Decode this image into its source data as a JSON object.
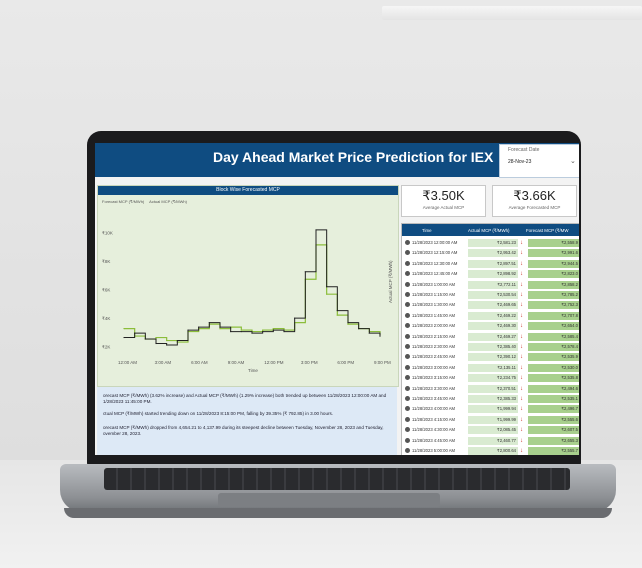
{
  "dashboard": {
    "title": "Day Ahead Market Price Prediction for IEX",
    "date_filter": {
      "label": "Forecast Date",
      "value": "28-Nov-23"
    },
    "kpis": [
      {
        "value": "₹3.50K",
        "label": "Average Actual MCP"
      },
      {
        "value": "₹3.66K",
        "label": "Average Forecasted MCP"
      }
    ],
    "chart": {
      "title": "Block Wise Forecasted MCP",
      "legend": [
        "Forecast MCP (₹/MWh)",
        "Actual MCP (₹/MWh)"
      ],
      "xlabel": "Time",
      "ylabel": "Actual MCP (₹/MWh)"
    },
    "insights": [
      "orecast MCP (₹/MWh) (3.62% increase) and Actual MCP (₹/MWh) (1.29% increase) both trended up between 11/28/2023 12:00:00 AM and 1/28/2023 11:45:00 PM.",
      "ctual MCP (₹/MWh) started trending down on 11/28/2023 8:15:00 PM, falling by 39.35% (₹ 792.85) in 3.00 hours.",
      "orecast MCP (₹/MWh) dropped from 4,654.21 to 4,137.99 during its steepest decline between Tuesday, November 28, 2023 and Tuesday, ovember 28, 2023."
    ],
    "table": {
      "headers": [
        "Time",
        "Actual MCP (₹/MWh)",
        "Forecast MCP (₹/MW"
      ],
      "rows": [
        [
          "11/28/2023 12:00:00 AM",
          "₹2,581.23",
          "₹2,558.9"
        ],
        [
          "11/28/2023 12:15:00 AM",
          "₹2,953.42",
          "₹2,991.6"
        ],
        [
          "11/28/2023 12:30:00 AM",
          "₹2,897.51",
          "₹2,944.5"
        ],
        [
          "11/28/2023 12:45:00 AM",
          "₹2,898.92",
          "₹2,823.0"
        ],
        [
          "11/28/2023 1:00:00 AM",
          "₹2,772.11",
          "₹2,858.2"
        ],
        [
          "11/28/2023 1:15:00 AM",
          "₹2,530.54",
          "₹2,785.2"
        ],
        [
          "11/28/2023 1:30:00 AM",
          "₹2,469.65",
          "₹2,752.3"
        ],
        [
          "11/28/2023 1:45:00 AM",
          "₹2,469.22",
          "₹2,707.8"
        ],
        [
          "11/28/2023 2:00:00 AM",
          "₹2,469.30",
          "₹2,654.0"
        ],
        [
          "11/28/2023 2:15:00 AM",
          "₹2,469.27",
          "₹2,585.4"
        ],
        [
          "11/28/2023 2:30:00 AM",
          "₹2,385.40",
          "₹2,578.4"
        ],
        [
          "11/28/2023 2:45:00 AM",
          "₹2,390.12",
          "₹2,535.9"
        ],
        [
          "11/28/2023 3:00:00 AM",
          "₹2,135.11",
          "₹2,530.0"
        ],
        [
          "11/28/2023 3:15:00 AM",
          "₹2,234.75",
          "₹2,535.8"
        ],
        [
          "11/28/2023 3:30:00 AM",
          "₹2,370.51",
          "₹2,494.6"
        ],
        [
          "11/28/2023 3:45:00 AM",
          "₹2,385.33",
          "₹2,535.1"
        ],
        [
          "11/28/2023 4:00:00 AM",
          "₹1,999.94",
          "₹2,496.7"
        ],
        [
          "11/28/2023 4:15:00 AM",
          "₹1,999.99",
          "₹2,555.6"
        ],
        [
          "11/28/2023 4:30:00 AM",
          "₹2,085.45",
          "₹2,607.5"
        ],
        [
          "11/28/2023 4:45:00 AM",
          "₹2,460.77",
          "₹2,655.3"
        ],
        [
          "11/28/2023 5:00:00 AM",
          "₹2,800.64",
          "₹2,555.7"
        ]
      ]
    }
  },
  "chart_data": {
    "type": "line",
    "title": "Block Wise Forecasted MCP",
    "xlabel": "Time",
    "ylabel": "Actual MCP (₹/MWh)",
    "x_ticks": [
      "12:00 AM",
      "3:00 AM",
      "6:00 AM",
      "9:00 AM",
      "12:00 PM",
      "3:00 PM",
      "6:00 PM",
      "9:00 PM"
    ],
    "y_ticks": [
      "₹2K",
      "₹4K",
      "₹6K",
      "₹8K",
      "₹10K"
    ],
    "ylim": [
      1500,
      11000
    ],
    "x": [
      0,
      1,
      2,
      3,
      4,
      5,
      6,
      7,
      8,
      9,
      10,
      11,
      12,
      13,
      14,
      15,
      16,
      17,
      18,
      19,
      20,
      21,
      22,
      23,
      24
    ],
    "series": [
      {
        "name": "Forecast MCP (₹/MWh)",
        "color": "#8bbd3a",
        "values": [
          3200,
          2700,
          2500,
          2600,
          2400,
          2300,
          3000,
          3200,
          3500,
          3200,
          3300,
          3100,
          3000,
          3100,
          3200,
          3100,
          3600,
          6500,
          8800,
          5500,
          4100,
          3500,
          3200,
          3000,
          2800
        ]
      },
      {
        "name": "Actual MCP (₹/MWh)",
        "color": "#222222",
        "values": [
          2600,
          2900,
          2500,
          2200,
          2100,
          2400,
          3100,
          3300,
          3600,
          3300,
          3000,
          3000,
          2900,
          3000,
          3100,
          3000,
          3900,
          7000,
          9800,
          6000,
          4400,
          3600,
          3200,
          2900,
          2700
        ]
      }
    ],
    "legend_position": "top-left",
    "grid": false
  },
  "colors": {
    "header": "#0f4c81",
    "chart_bg": "#e6efdc",
    "forecast_cell": "#a8d08d",
    "actual_cell": "#d9ebd1",
    "down_arrow": "#c8281e"
  }
}
